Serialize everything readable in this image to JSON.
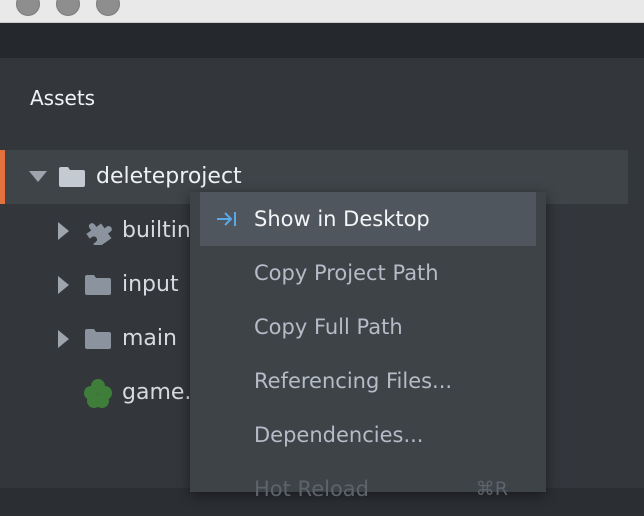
{
  "window": {
    "controls": [
      "close",
      "minimize",
      "zoom"
    ]
  },
  "assets_panel": {
    "title": "Assets",
    "tree": [
      {
        "label": "deleteproject",
        "icon": "folder-icon",
        "expanded": true,
        "selected": true
      },
      {
        "label": "builtin",
        "icon": "puzzle-icon"
      },
      {
        "label": "input",
        "icon": "folder-icon"
      },
      {
        "label": "main",
        "icon": "folder-icon"
      },
      {
        "label": "game.",
        "icon": "game-project-icon"
      }
    ]
  },
  "context_menu": {
    "items": [
      {
        "label": "Show in Desktop",
        "icon": "show-in-desktop-icon",
        "highlighted": true
      },
      {
        "label": "Copy Project Path"
      },
      {
        "label": "Copy Full Path"
      },
      {
        "label": "Referencing Files..."
      },
      {
        "label": "Dependencies..."
      },
      {
        "label": "Hot Reload",
        "shortcut": "⌘R",
        "disabled": true
      }
    ]
  },
  "colors": {
    "selection_accent": "#e2713d",
    "menu_icon": "#5aa9e6",
    "game_icon": "#3e7d3a"
  }
}
